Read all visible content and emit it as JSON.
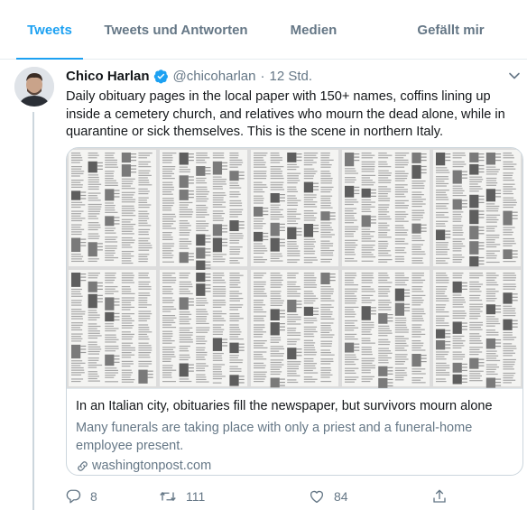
{
  "tabs": [
    {
      "label": "Tweets",
      "active": true
    },
    {
      "label": "Tweets und Antworten",
      "active": false
    },
    {
      "label": "Medien",
      "active": false
    },
    {
      "label": "Gefällt mir",
      "active": false
    }
  ],
  "tweet": {
    "author_name": "Chico Harlan",
    "handle": "@chicoharlan",
    "separator": "·",
    "time": "12 Std.",
    "text": "Daily obituary pages in the local paper with 150+ names, coffins lining up inside a cemetery church, and relatives who mourn the dead alone, while in quarantine or sick themselves. This is the scene in northern Italy.",
    "card": {
      "title": "In an Italian city, obituaries fill the newspaper, but survivors mourn alone",
      "description": "Many funerals are taking place with only a priest and a funeral-home employee present.",
      "domain": "washingtonpost.com"
    },
    "counts": {
      "replies": "8",
      "retweets": "111",
      "likes": "84"
    }
  },
  "icons": {
    "verified": "verified-badge-icon",
    "caret": "chevron-down-icon",
    "link": "link-icon",
    "reply": "reply-icon",
    "retweet": "retweet-icon",
    "like": "heart-icon",
    "share": "share-icon"
  },
  "colors": {
    "accent": "#1da1f2",
    "secondary_text": "#657786",
    "primary_text": "#14171a",
    "border": "#e6ecf0"
  }
}
